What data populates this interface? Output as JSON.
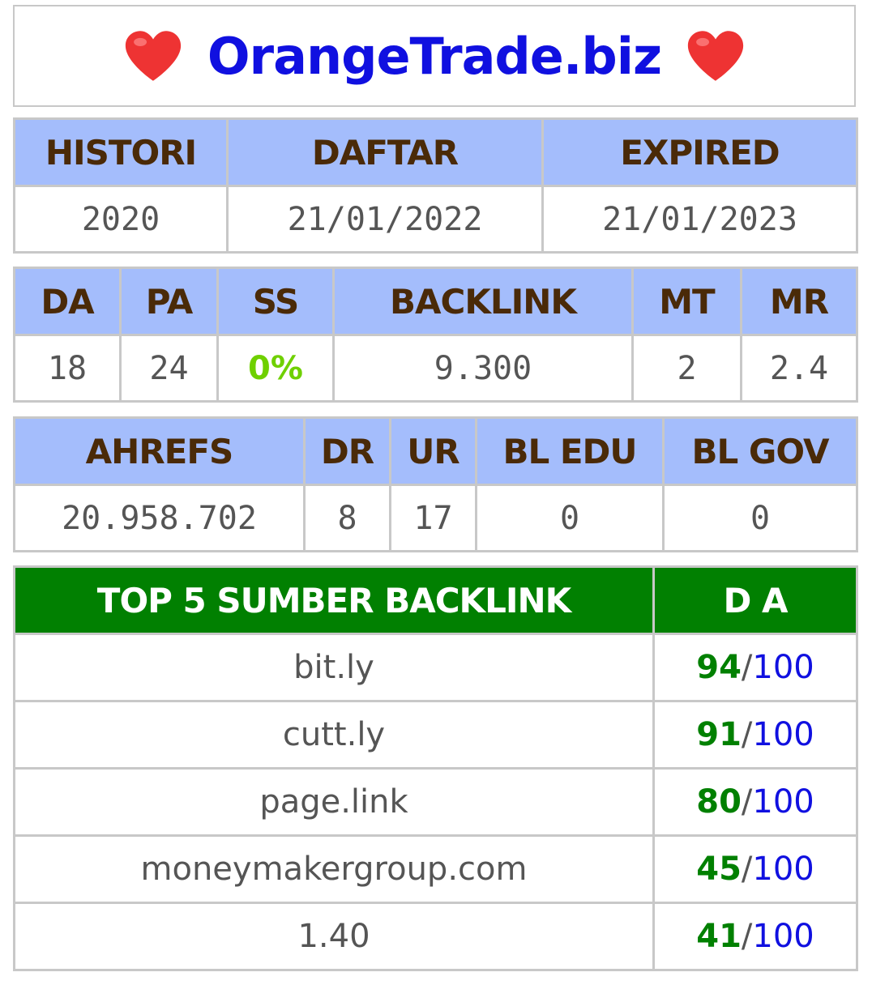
{
  "header": {
    "title": "OrangeTrade.biz",
    "left_icon": "heart-icon",
    "right_icon": "heart-icon",
    "title_color": "#1010e0",
    "heart_color": "#ee3333"
  },
  "domain_info": {
    "headers": [
      "HISTORI",
      "DAFTAR",
      "EXPIRED"
    ],
    "values": [
      "2020",
      "21/01/2022",
      "21/01/2023"
    ]
  },
  "metrics": {
    "headers": [
      "DA",
      "PA",
      "SS",
      "BACKLINK",
      "MT",
      "MR"
    ],
    "values": [
      "18",
      "24",
      "0%",
      "9.300",
      "2",
      "2.4"
    ]
  },
  "ahrefs": {
    "headers": [
      "AHREFS",
      "DR",
      "UR",
      "BL EDU",
      "BL GOV"
    ],
    "values": [
      "20.958.702",
      "8",
      "17",
      "0",
      "0"
    ]
  },
  "top_backlinks": {
    "header_source": "TOP 5 SUMBER BACKLINK",
    "header_da": "D A",
    "separator": "/",
    "max": "100",
    "rows": [
      {
        "source": "bit.ly",
        "da": "94"
      },
      {
        "source": "cutt.ly",
        "da": "91"
      },
      {
        "source": "page.link",
        "da": "80"
      },
      {
        "source": "moneymakergroup.com",
        "da": "45"
      },
      {
        "source": "1.40",
        "da": "41"
      }
    ]
  },
  "colors": {
    "header_blue": "#a4bdfc",
    "header_text": "#4a2a08",
    "green_header": "#018001",
    "ss_green": "#6fd000",
    "link_blue": "#1010e0"
  }
}
